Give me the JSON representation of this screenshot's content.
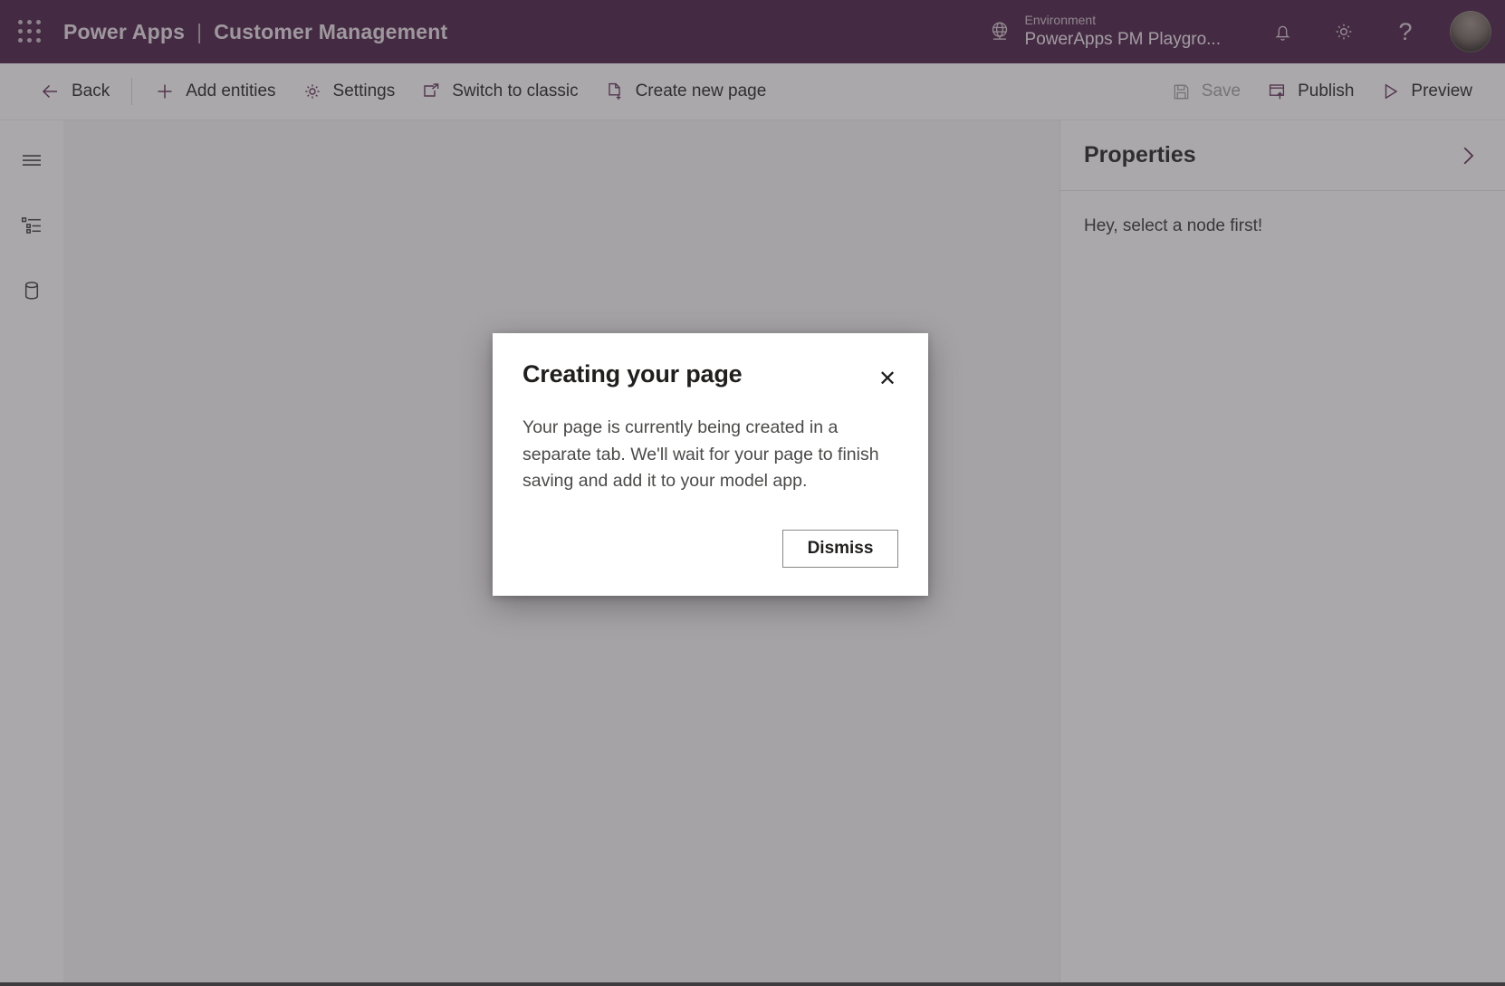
{
  "header": {
    "waffle_icon": "app-launcher-icon",
    "product_name": "Power Apps",
    "separator": "|",
    "app_name": "Customer Management",
    "environment_icon": "globe-icon",
    "environment_label": "Environment",
    "environment_value": "PowerApps PM Playgro...",
    "notifications_icon": "bell-icon",
    "settings_icon": "gear-icon",
    "help_icon": "question-mark-icon",
    "help_glyph": "?",
    "avatar_name": "user-avatar",
    "background_color": "#451B42"
  },
  "commandbar": {
    "back": "Back",
    "add_entities": "Add entities",
    "settings": "Settings",
    "switch_to_classic": "Switch to classic",
    "create_new_page": "Create new page",
    "save": "Save",
    "publish": "Publish",
    "preview": "Preview",
    "save_disabled": true,
    "accent_color": "#5c2e55"
  },
  "rail": {
    "items": [
      {
        "name": "hamburger-menu-icon",
        "label": "Menu"
      },
      {
        "name": "tree-view-icon",
        "label": "Navigation"
      },
      {
        "name": "database-icon",
        "label": "Data"
      }
    ]
  },
  "properties_panel": {
    "title": "Properties",
    "collapse_icon": "chevron-right-icon",
    "empty_message": "Hey, select a node first!"
  },
  "dialog": {
    "title": "Creating your page",
    "close_icon": "close-icon",
    "close_glyph": "✕",
    "body": "Your page is currently being created in a separate tab. We'll wait for your page to finish saving and add it to your model app.",
    "dismiss_button": "Dismiss"
  }
}
